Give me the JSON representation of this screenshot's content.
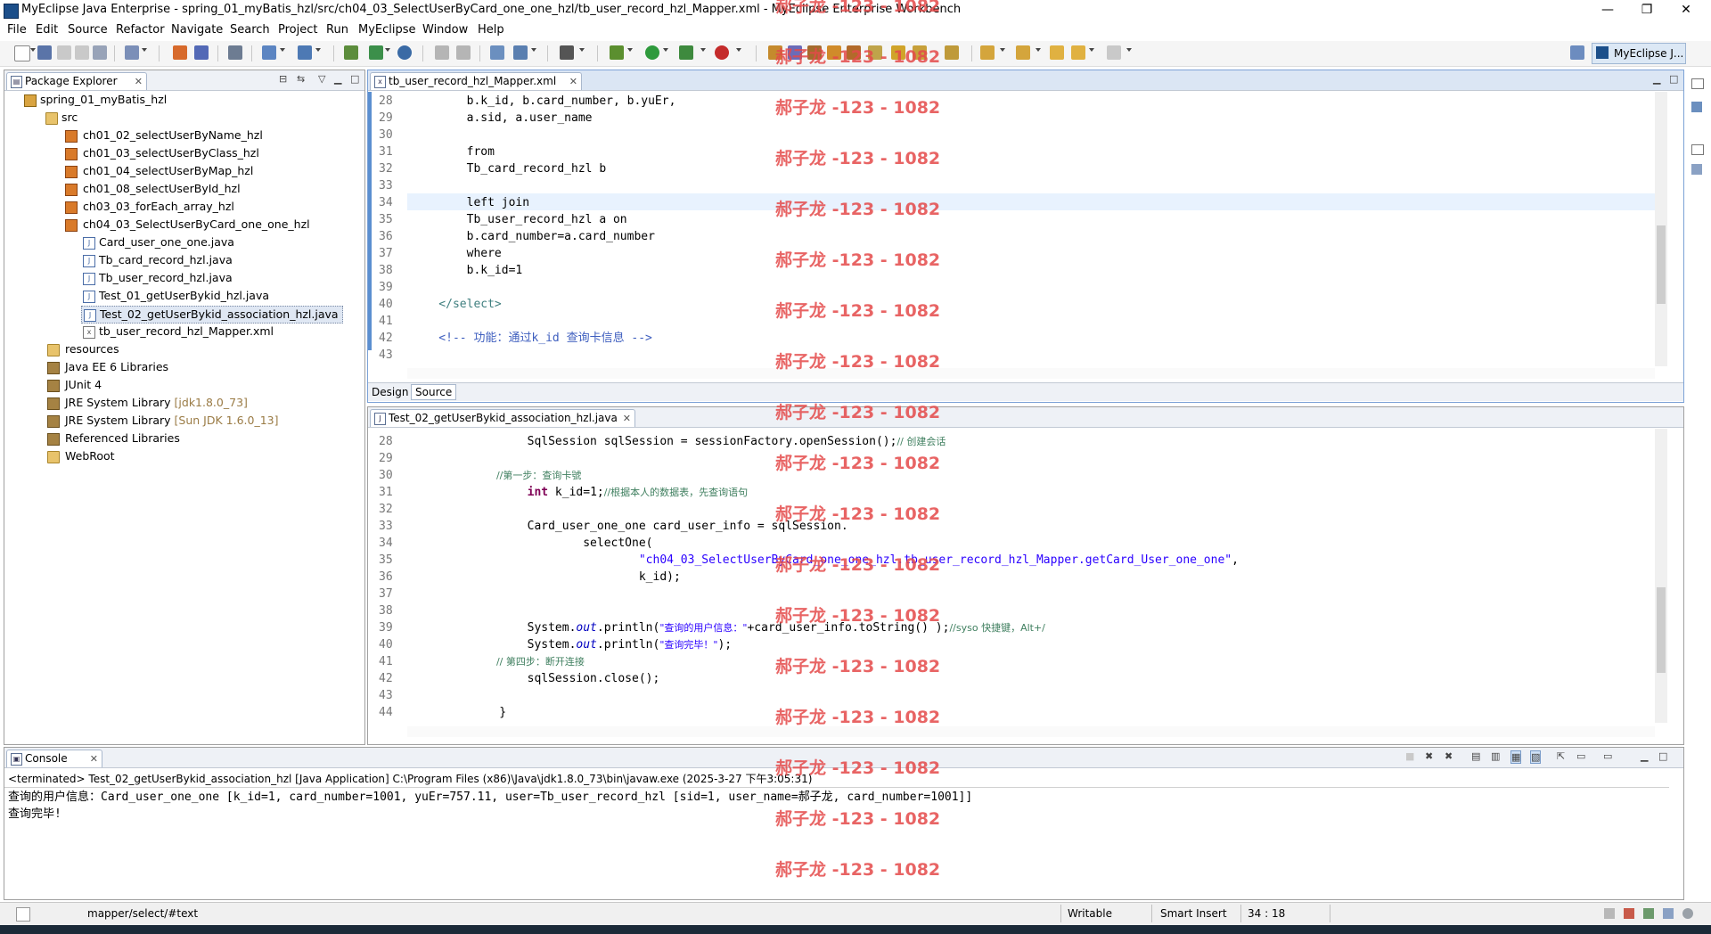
{
  "window": {
    "title": "MyEclipse Java Enterprise - spring_01_myBatis_hzl/src/ch04_03_SelectUserByCard_one_one_hzl/tb_user_record_hzl_Mapper.xml - MyEclipse Enterprise Workbench",
    "controls": [
      "—",
      "❐",
      "✕"
    ]
  },
  "menu": [
    "File",
    "Edit",
    "Source",
    "Refactor",
    "Navigate",
    "Search",
    "Project",
    "Run",
    "MyEclipse",
    "Window",
    "Help"
  ],
  "perspective": {
    "label": "MyEclipse J..."
  },
  "package_explorer": {
    "tab": "Package Explorer",
    "tree": [
      {
        "label": "spring_01_myBatis_hzl",
        "icon": "project-icon",
        "type": "project"
      },
      {
        "label": "src",
        "icon": "source-folder-icon",
        "type": "folder"
      },
      {
        "label": "ch01_02_selectUserByName_hzl",
        "icon": "package-icon",
        "type": "pkg"
      },
      {
        "label": "ch01_03_selectUserByClass_hzl",
        "icon": "package-icon",
        "type": "pkg"
      },
      {
        "label": "ch01_04_selectUserByMap_hzl",
        "icon": "package-icon",
        "type": "pkg"
      },
      {
        "label": "ch01_08_selectUserById_hzl",
        "icon": "package-icon",
        "type": "pkg"
      },
      {
        "label": "ch03_03_forEach_array_hzl",
        "icon": "package-icon",
        "type": "pkg"
      },
      {
        "label": "ch04_03_SelectUserByCard_one_one_hzl",
        "icon": "package-icon",
        "type": "pkg"
      },
      {
        "label": "Card_user_one_one.java",
        "icon": "java-file-icon",
        "type": "java"
      },
      {
        "label": "Tb_card_record_hzl.java",
        "icon": "java-file-icon",
        "type": "java"
      },
      {
        "label": "Tb_user_record_hzl.java",
        "icon": "java-file-icon",
        "type": "java"
      },
      {
        "label": "Test_01_getUserBykid_hzl.java",
        "icon": "java-file-icon",
        "type": "java"
      },
      {
        "label": "Test_02_getUserBykid_association_hzl.java",
        "icon": "java-file-icon",
        "type": "java",
        "selected": true
      },
      {
        "label": "tb_user_record_hzl_Mapper.xml",
        "icon": "xml-file-icon",
        "type": "xml"
      },
      {
        "label": "resources",
        "icon": "folder-icon",
        "type": "folder"
      },
      {
        "label": "Java EE 6 Libraries",
        "icon": "library-icon",
        "type": "lib"
      },
      {
        "label": "JUnit 4",
        "icon": "library-icon",
        "type": "lib"
      },
      {
        "label": "JRE System Library",
        "suffix": "[jdk1.8.0_73]",
        "icon": "library-icon",
        "type": "lib"
      },
      {
        "label": "JRE System Library",
        "suffix": "[Sun JDK 1.6.0_13]",
        "icon": "library-icon",
        "type": "lib"
      },
      {
        "label": "Referenced Libraries",
        "icon": "library-icon",
        "type": "lib"
      },
      {
        "label": "WebRoot",
        "icon": "folder-icon",
        "type": "folder"
      }
    ]
  },
  "xml_editor": {
    "tab": "tb_user_record_hzl_Mapper.xml",
    "bottom_tabs": [
      "Design",
      "Source"
    ],
    "lines": [
      {
        "n": "28",
        "text": "        b.k_id, b.card_number, b.yuEr,"
      },
      {
        "n": "29",
        "text": "        a.sid, a.user_name"
      },
      {
        "n": "30",
        "text": ""
      },
      {
        "n": "31",
        "text": "        from"
      },
      {
        "n": "32",
        "text": "        Tb_card_record_hzl b"
      },
      {
        "n": "33",
        "text": ""
      },
      {
        "n": "34",
        "text": "        left join"
      },
      {
        "n": "35",
        "text": "        Tb_user_record_hzl a on"
      },
      {
        "n": "36",
        "text": "        b.card_number=a.card_number"
      },
      {
        "n": "37",
        "text": "        where"
      },
      {
        "n": "38",
        "text": "        b.k_id=1"
      },
      {
        "n": "39",
        "text": ""
      },
      {
        "n": "40",
        "text": "    </select>"
      },
      {
        "n": "41",
        "text": ""
      },
      {
        "n": "42",
        "text": "    <!-- 功能：通过k_id 查询卡信息 -->"
      },
      {
        "n": "43",
        "text": ""
      }
    ]
  },
  "java_editor": {
    "tab": "Test_02_getUserBykid_association_hzl.java",
    "lines": {
      "n": [
        "28",
        "29",
        "30",
        "31",
        "32",
        "33",
        "34",
        "35",
        "36",
        "37",
        "38",
        "39",
        "40",
        "41",
        "42",
        "43",
        "44"
      ],
      "l28a": "        SqlSession sqlSession = sessionFactory.openSession();",
      "l28b": "// 创建会话",
      "l30": "        //第一步：查询卡號",
      "l31kw": "int",
      "l31a": " k_id=1;",
      "l31b": "//根据本人的数据表，先查询语句",
      "l33": "        Card_user_one_one card_user_info = sqlSession.",
      "l34": "                selectOne(",
      "l35": "\"ch04_03_SelectUserByCard_one_one_hzl.tb_user_record_hzl_Mapper.getCard_User_one_one\"",
      "l35tail": ",",
      "l36": "                        k_id);",
      "l39a": "        System.",
      "l39out": "out",
      "l39b": ".println(",
      "l39str": "\"查询的用户信息：\"",
      "l39c": "+card_user_info.toString() );",
      "l39cmt": "//syso 快捷键，Alt+/",
      "l40a": "        System.",
      "l40b": ".println(",
      "l40str": "\"查询完毕！\"",
      "l40c": ");",
      "l41": "        // 第四步：断开连接",
      "l42": "        sqlSession.close();",
      "l44": "    }"
    }
  },
  "console": {
    "tab": "Console",
    "header": "<terminated> Test_02_getUserBykid_association_hzl [Java Application] C:\\Program Files (x86)\\Java\\jdk1.8.0_73\\bin\\javaw.exe (2025-3-27 下午3:05:31)",
    "output": [
      "查询的用户信息：Card_user_one_one [k_id=1, card_number=1001, yuEr=757.11, user=Tb_user_record_hzl [sid=1, user_name=郝子龙, card_number=1001]]",
      "查询完毕!"
    ]
  },
  "statusbar": {
    "path": "mapper/select/#text",
    "writable": "Writable",
    "insert_mode": "Smart Insert",
    "position": "34 : 18"
  },
  "watermark": "郝子龙 -123 - 1082",
  "colors": {
    "keyword": "#7f0055",
    "string": "#2a00ff",
    "comment": "#3f7f5f",
    "watermark": "#e44a4a"
  }
}
